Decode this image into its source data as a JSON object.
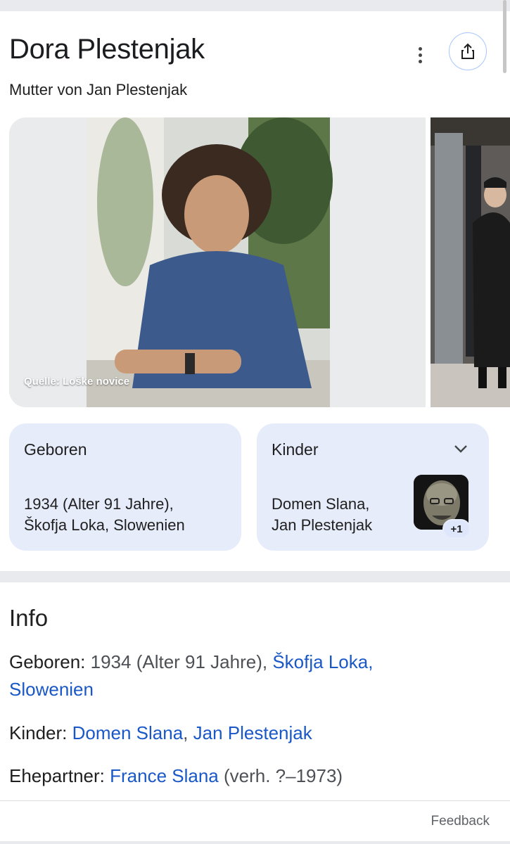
{
  "header": {
    "title": "Dora Plestenjak",
    "subtitle": "Mutter von Jan Plestenjak"
  },
  "images": {
    "source_credit": "Quelle: Loške novice"
  },
  "cards": {
    "born": {
      "title": "Geboren",
      "line1": "1934 (Alter 91 Jahre),",
      "line2": "Škofja Loka, Slowenien"
    },
    "children": {
      "title": "Kinder",
      "line1": "Domen Slana,",
      "line2": "Jan Plestenjak",
      "more_count": "+1"
    }
  },
  "info": {
    "heading": "Info",
    "born": {
      "label": "Geboren:",
      "text": " 1934 (Alter 91 Jahre), ",
      "link_1": "Škofja Loka,",
      "link_2": "Slowenien"
    },
    "children": {
      "label": "Kinder:",
      "link_1": "Domen Slana",
      "separator": ", ",
      "link_2": "Jan Plestenjak"
    },
    "spouse": {
      "label": "Ehepartner:",
      "link": "France Slana",
      "text": " (verh. ?–1973)"
    }
  },
  "footer": {
    "feedback": "Feedback"
  },
  "colors": {
    "link": "#1a58c7",
    "card_background": "#e7ecfb",
    "share_border": "#a8c7fa"
  },
  "icons": [
    "more-vert-icon",
    "share-icon",
    "chevron-down-icon"
  ]
}
